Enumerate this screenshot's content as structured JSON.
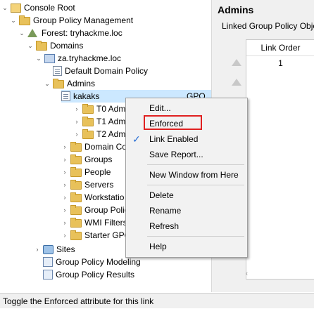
{
  "tree": {
    "console_root": "Console Root",
    "gpm": "Group Policy Management",
    "forest": "Forest: tryhackme.loc",
    "domains": "Domains",
    "domain": "za.tryhackme.loc",
    "default_domain_policy": "Default Domain Policy",
    "admins": "Admins",
    "kakaks": "kakaks",
    "kakaks_suffix": "GPO",
    "t0": "T0 Adm",
    "t1": "T1 Adm",
    "t2": "T2 Adm",
    "domain_controllers": "Domain Co",
    "groups": "Groups",
    "people": "People",
    "servers": "Servers",
    "workstations": "Workstatio",
    "group_policy_objects": "Group Polic",
    "wmi_filters": "WMI Filters",
    "starter_gpos": "Starter GPO",
    "sites": "Sites",
    "gp_modeling": "Group Policy Modeling",
    "gp_results": "Group Policy Results"
  },
  "right": {
    "title": "Admins",
    "tab": "Linked Group Policy Object",
    "column_header": "Link Order",
    "cell_value": "1"
  },
  "context_menu": {
    "edit": "Edit...",
    "enforced": "Enforced",
    "link_enabled": "Link Enabled",
    "save_report": "Save Report...",
    "new_window": "New Window from Here",
    "delete": "Delete",
    "rename": "Rename",
    "refresh": "Refresh",
    "help": "Help"
  },
  "status_bar": "Toggle the Enforced attribute for this link",
  "colors": {
    "highlight_border": "#e02020",
    "selection": "#cce8ff",
    "check": "#2a6fd4"
  }
}
